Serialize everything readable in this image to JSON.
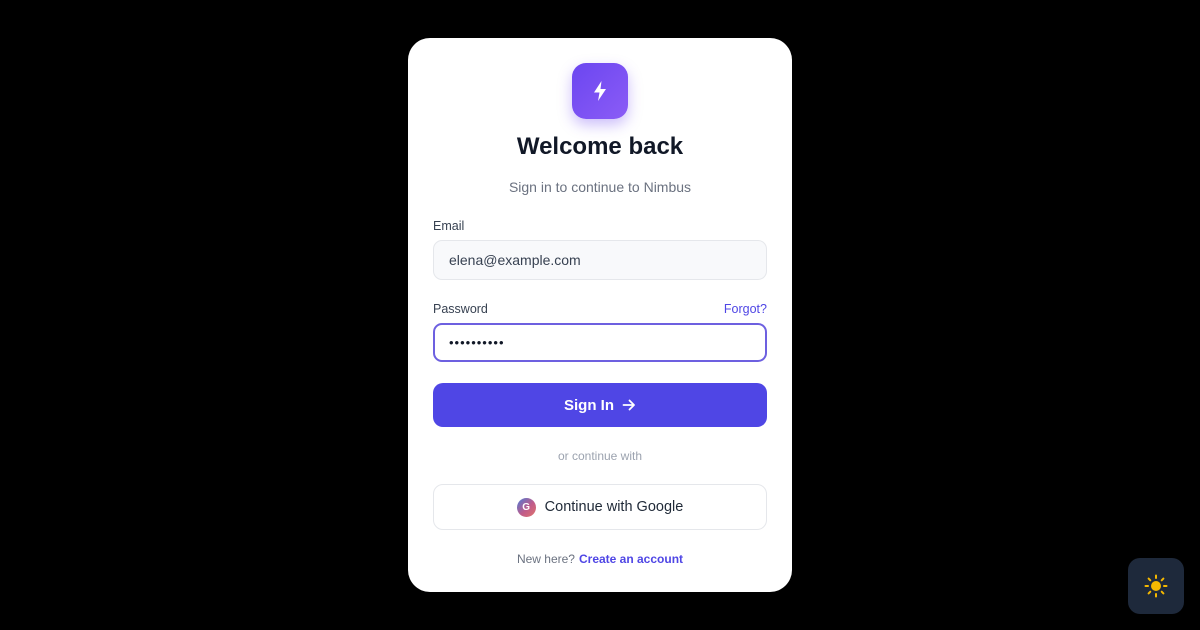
{
  "brand": {
    "logo_icon": "lightning-bolt-icon",
    "accent_color": "#4f46e5",
    "logo_gradient": [
      "#6b46f0",
      "#8b5cf6"
    ]
  },
  "header": {
    "title": "Welcome back",
    "subtitle": "Sign in to continue to Nimbus"
  },
  "form": {
    "email": {
      "label": "Email",
      "value": "elena@example.com"
    },
    "password": {
      "label": "Password",
      "value": "••••••••••",
      "forgot_label": "Forgot?"
    },
    "submit": {
      "label": "Sign In",
      "icon": "arrow-right-icon"
    }
  },
  "alt_login": {
    "divider_text": "or continue with",
    "google_label": "Continue with Google",
    "google_icon": "google-icon",
    "google_icon_letter": "G"
  },
  "footer": {
    "prompt": "New here?",
    "link_label": "Create an account"
  },
  "theme_toggle": {
    "icon": "sun-icon",
    "icon_color": "#f5b800"
  }
}
